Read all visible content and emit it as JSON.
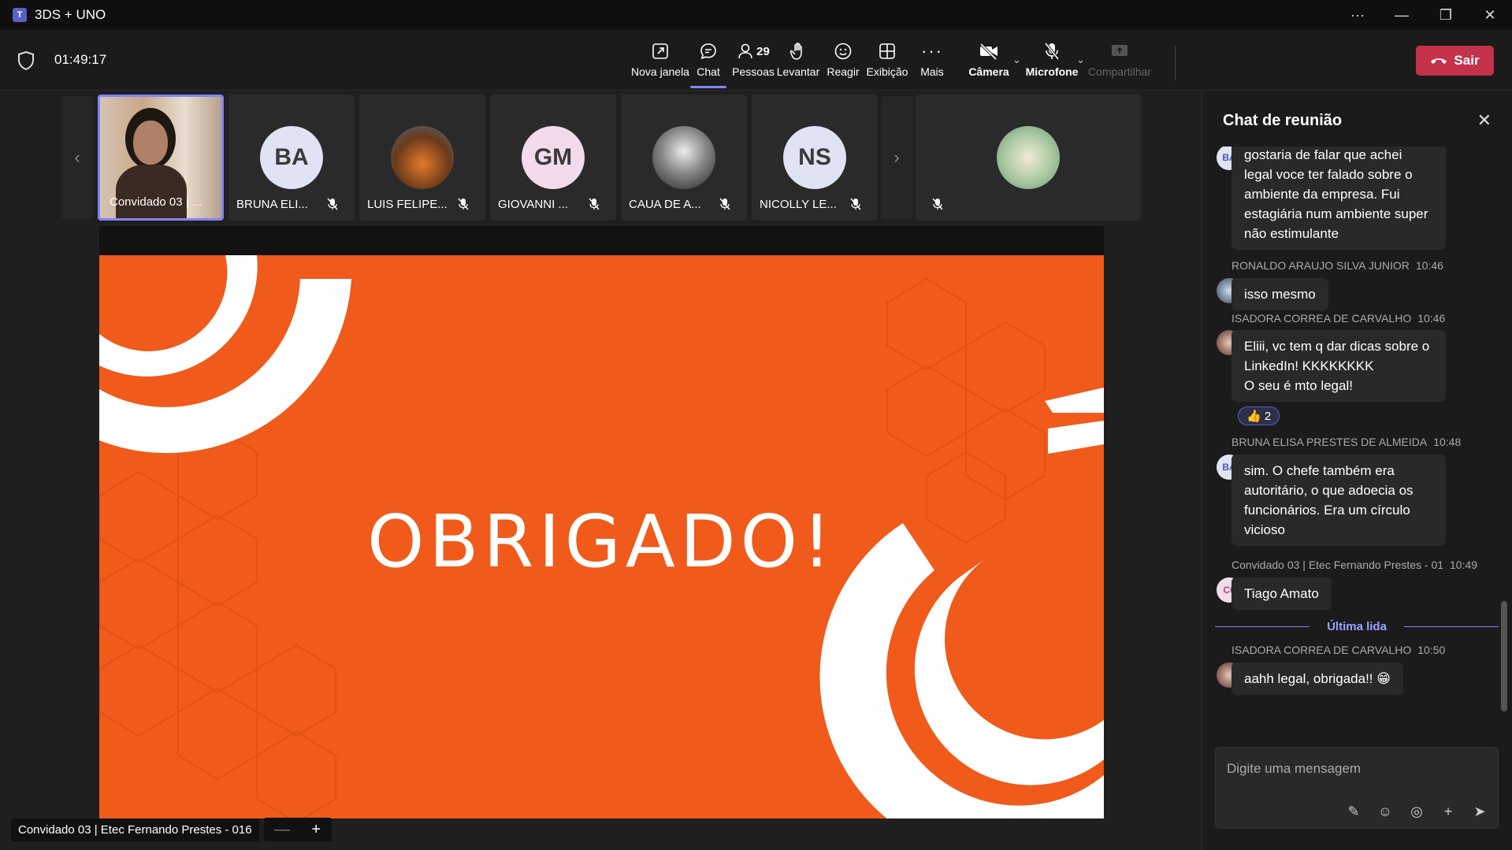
{
  "window": {
    "title": "3DS + UNO"
  },
  "toolbar": {
    "timer": "01:49:17",
    "buttons": {
      "new_window": "Nova janela",
      "chat": "Chat",
      "people": "Pessoas",
      "people_count": "29",
      "raise": "Levantar",
      "react": "Reagir",
      "view": "Exibição",
      "more": "Mais",
      "camera": "Câmera",
      "mic": "Microfone",
      "share": "Compartilhar",
      "leave": "Sair"
    }
  },
  "participants": [
    {
      "name": "Convidado 03 | ...",
      "initials": "",
      "color": ""
    },
    {
      "name": "BRUNA ELI...",
      "initials": "BA",
      "color": "#dfe3f3"
    },
    {
      "name": "LUIS FELIPE...",
      "initials": "",
      "color": ""
    },
    {
      "name": "GIOVANNI ...",
      "initials": "GM",
      "color": "#f2dcec"
    },
    {
      "name": "CAUA DE A...",
      "initials": "",
      "color": ""
    },
    {
      "name": "NICOLLY LE...",
      "initials": "NS",
      "color": "#dfe3f3"
    },
    {
      "name": "",
      "initials": "",
      "color": ""
    }
  ],
  "slide": {
    "text": "OBRIGADO!"
  },
  "stage_footer": {
    "presenter": "Convidado 03 | Etec Fernando Prestes - 016",
    "zoom_out": "—",
    "zoom_in": "+"
  },
  "chat": {
    "title": "Chat de reunião",
    "messages": [
      {
        "author": "",
        "time": "",
        "initials": "BA",
        "lines": [
          "gostaria de falar que achei",
          "legal voce ter falado sobre o",
          "ambiente da empresa. Fui",
          "estagiária num ambiente super",
          "não estimulante"
        ]
      },
      {
        "author": "RONALDO ARAUJO SILVA JUNIOR",
        "time": "10:46",
        "initials": "",
        "lines": [
          "isso mesmo"
        ]
      },
      {
        "author": "ISADORA CORREA DE CARVALHO",
        "time": "10:46",
        "initials": "",
        "lines": [
          "Eliii, vc tem q dar dicas sobre o",
          "LinkedIn! KKKKKKKK",
          "O seu é mto legal!"
        ],
        "reaction": "👍 2"
      },
      {
        "author": "BRUNA ELISA PRESTES DE ALMEIDA",
        "time": "10:48",
        "initials": "BA",
        "lines": [
          "sim. O chefe também era",
          "autoritário, o que adoecia os",
          "funcionários. Era um círculo",
          "vicioso"
        ]
      },
      {
        "author": "Convidado 03 | Etec Fernando Prestes - 01",
        "time": "10:49",
        "initials": "C0",
        "lines": [
          "Tiago Amato"
        ]
      },
      {
        "author": "ISADORA CORREA DE CARVALHO",
        "time": "10:50",
        "initials": "",
        "lines": [
          "aahh legal, obrigada!! 😁"
        ]
      }
    ],
    "last_read": "Última lida",
    "compose_placeholder": "Digite uma mensagem"
  }
}
